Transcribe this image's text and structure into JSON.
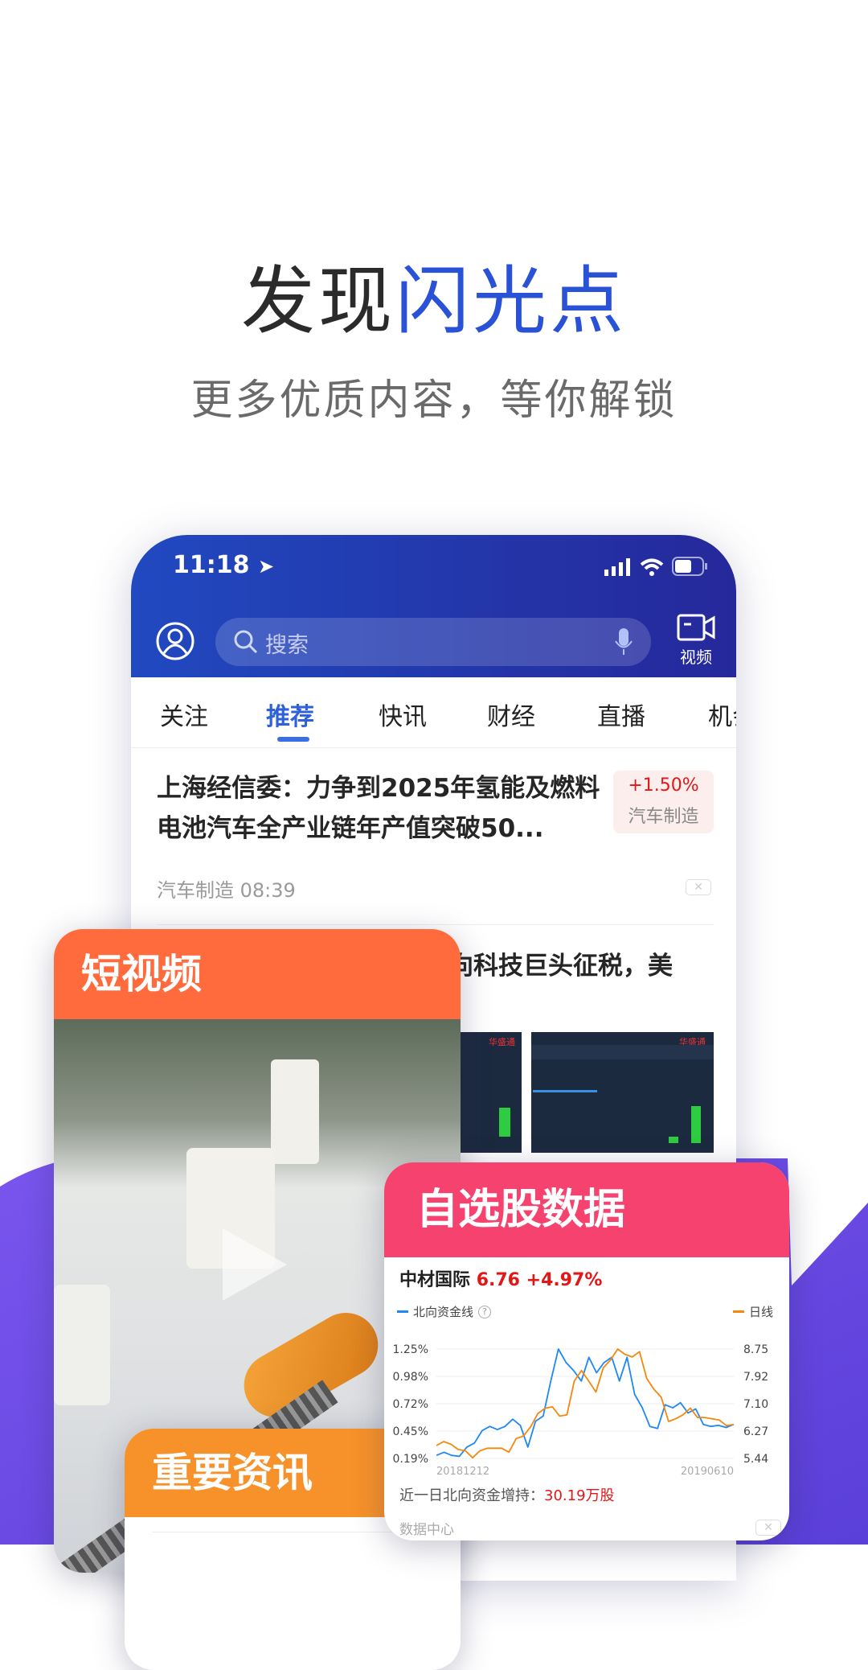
{
  "hero": {
    "title_dark": "发现",
    "title_blue": "闪光点",
    "subtitle": "更多优质内容，等你解锁"
  },
  "colors": {
    "blue": "#2a52d6",
    "purple": "#6b4ee6",
    "orange": "#ff6b3d",
    "amber": "#f7922a",
    "pink": "#f5426e",
    "red": "#e01818"
  },
  "phone": {
    "status": {
      "time": "11:18",
      "icons": [
        "location-arrow-icon",
        "signal-icon",
        "wifi-icon",
        "battery-icon"
      ]
    },
    "header": {
      "search_placeholder": "搜索",
      "video_label": "视频"
    },
    "tabs": [
      {
        "label": "关注"
      },
      {
        "label": "推荐",
        "active": true
      },
      {
        "label": "快讯"
      },
      {
        "label": "财经"
      },
      {
        "label": "直播"
      },
      {
        "label": "机会"
      }
    ],
    "news": [
      {
        "title": "上海经信委：力争到2025年氢能及燃料电池汽车全产业链年产值突破50...",
        "change": "+1.50%",
        "sector": "汽车制造",
        "meta": "汽车制造 08:39"
      },
      {
        "title": "向科技巨头征税，美"
      }
    ],
    "thumb_logo": "华盛通"
  },
  "cards": {
    "video": {
      "title": "短视频"
    },
    "news": {
      "title": "重要资讯"
    },
    "stock": {
      "title": "自选股数据",
      "name": "中材国际",
      "price": "6.76",
      "change": "+4.97%",
      "legend_left": "北向资金线",
      "legend_right": "日线",
      "footer_label": "近一日北向资金增持：",
      "footer_value": "30.19万股",
      "source": "数据中心"
    }
  },
  "chart_data": {
    "type": "line",
    "x_start": "20181212",
    "x_end": "20190610",
    "y_left_ticks": [
      "1.25%",
      "0.98%",
      "0.72%",
      "0.45%",
      "0.19%"
    ],
    "y_right_ticks": [
      "8.75",
      "7.92",
      "7.10",
      "6.27",
      "5.44"
    ],
    "ylim_left": [
      0.19,
      1.25
    ],
    "ylim_right": [
      5.44,
      8.75
    ],
    "grid": true,
    "series": [
      {
        "name": "北向资金线",
        "axis": "left",
        "color": "#1e88f5",
        "values": [
          0.22,
          0.25,
          0.22,
          0.21,
          0.3,
          0.34,
          0.46,
          0.5,
          0.47,
          0.5,
          0.57,
          0.51,
          0.3,
          0.55,
          0.6,
          0.94,
          1.25,
          1.12,
          1.04,
          0.94,
          1.17,
          1.02,
          1.12,
          1.17,
          0.94,
          1.17,
          0.81,
          0.68,
          0.5,
          0.48,
          0.71,
          0.68,
          0.73,
          0.63,
          0.67,
          0.52,
          0.5,
          0.51,
          0.49,
          0.52
        ]
      },
      {
        "name": "日线",
        "axis": "right",
        "color": "#f5870f",
        "values": [
          5.83,
          5.95,
          5.87,
          5.71,
          5.67,
          5.46,
          5.67,
          5.75,
          5.75,
          5.75,
          5.63,
          6.04,
          6.12,
          6.4,
          6.8,
          6.96,
          7.0,
          6.72,
          6.76,
          7.78,
          8.1,
          7.78,
          7.45,
          8.18,
          8.42,
          8.75,
          8.59,
          8.51,
          8.67,
          7.86,
          7.53,
          7.29,
          6.56,
          6.64,
          6.76,
          6.96,
          6.68,
          6.68,
          6.64,
          6.6,
          6.43,
          6.47
        ]
      }
    ]
  }
}
